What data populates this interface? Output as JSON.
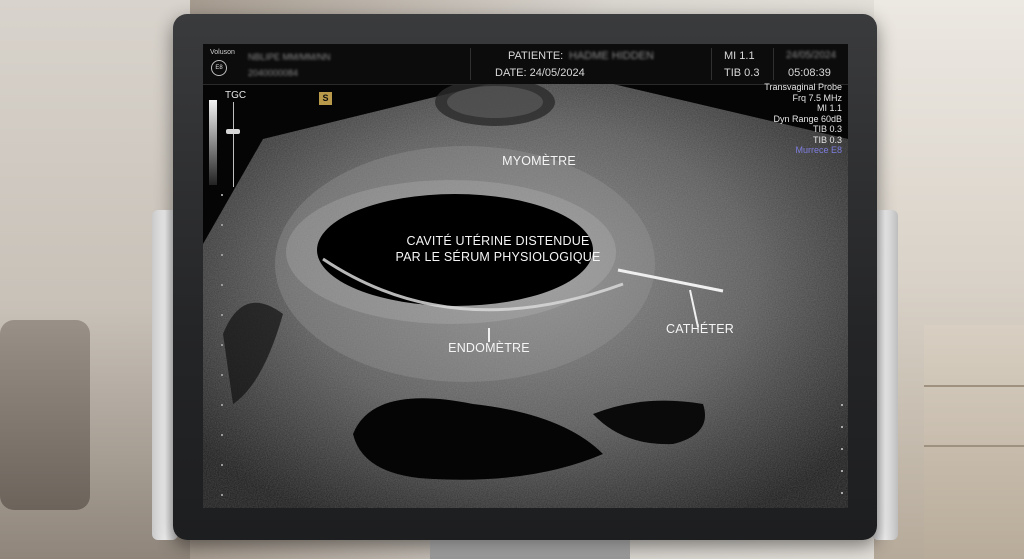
{
  "header": {
    "brand": "Voluson",
    "brand_model": "E8",
    "patient_label": "PATIENTE:",
    "patient_name": "HADME HIDDEN",
    "date_label": "DATE: 24/05/2024",
    "mi": "MI 1.1",
    "tib": "TIB 0.3",
    "date_right": "24/05/2024",
    "time": "05:08:39",
    "blurred_line1": "NBLIPE MM/MM/NN",
    "blurred_line2": "2040000084"
  },
  "probe_info": [
    "Transvaginal Probe",
    "Frq  7.5 MHz",
    "MI 1.1",
    "Dyn Range 60dB",
    "TIB 0.3",
    "TIB 0.3",
    "Murrece E8"
  ],
  "controls": {
    "tgc_label": "TGC",
    "s_badge": "S"
  },
  "annotations": {
    "myometre": "MYOMÈTRE",
    "cavity_line1": "CAVITÉ UTÉRINE DISTENDUE",
    "cavity_line2": "PAR LE SÉRUM PHYSIOLOGIQUE",
    "endometre": "ENDOMÈTRE",
    "catheter": "CATHÉTER"
  },
  "colors": {
    "accent_brand": "#7e7ee0",
    "s_badge": "#b89a4a"
  }
}
